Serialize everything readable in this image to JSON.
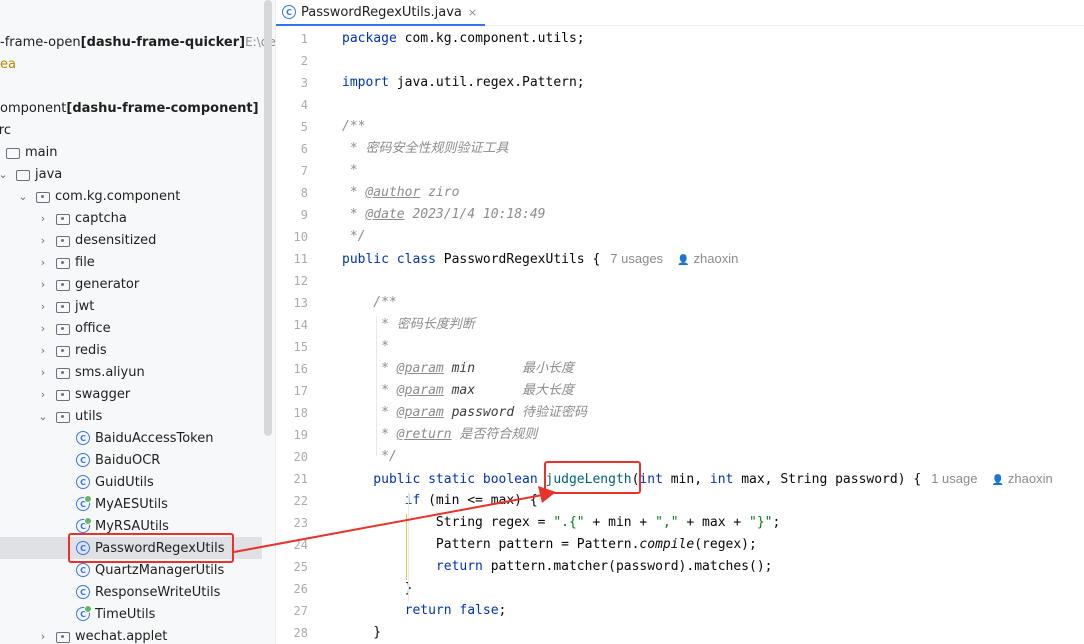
{
  "tree": {
    "rows": [
      {
        "parts": [
          {
            "t": "-frame-open ",
            "c": ""
          },
          {
            "t": "[dashu-frame-quicker]",
            "c": "bold"
          },
          {
            "t": "  E:\\de",
            "c": "dim"
          }
        ]
      },
      {
        "parts": [
          {
            "t": "ea",
            "c": "modcol"
          }
        ]
      },
      {
        "parts": []
      },
      {
        "parts": [
          {
            "t": "omponent ",
            "c": ""
          },
          {
            "t": "[dashu-frame-component]",
            "c": "bold"
          }
        ]
      },
      {
        "parts": [
          {
            "t": "src",
            "c": ""
          }
        ]
      },
      {
        "parts": [
          {
            "t": "main",
            "c": ""
          }
        ]
      },
      {
        "parts": [
          {
            "t": "java",
            "c": ""
          }
        ]
      },
      {
        "parts": [
          {
            "t": "com.kg.component",
            "c": ""
          }
        ]
      },
      {
        "parts": [
          {
            "t": "captcha",
            "c": ""
          }
        ]
      },
      {
        "parts": [
          {
            "t": "desensitized",
            "c": ""
          }
        ]
      },
      {
        "parts": [
          {
            "t": "file",
            "c": ""
          }
        ]
      },
      {
        "parts": [
          {
            "t": "generator",
            "c": ""
          }
        ]
      },
      {
        "parts": [
          {
            "t": "jwt",
            "c": ""
          }
        ]
      },
      {
        "parts": [
          {
            "t": "office",
            "c": ""
          }
        ]
      },
      {
        "parts": [
          {
            "t": "redis",
            "c": ""
          }
        ]
      },
      {
        "parts": [
          {
            "t": "sms.aliyun",
            "c": ""
          }
        ]
      },
      {
        "parts": [
          {
            "t": "swagger",
            "c": ""
          }
        ]
      },
      {
        "parts": [
          {
            "t": "utils",
            "c": ""
          }
        ]
      },
      {
        "parts": [
          {
            "t": "BaiduAccessToken",
            "c": ""
          }
        ]
      },
      {
        "parts": [
          {
            "t": "BaiduOCR",
            "c": ""
          }
        ]
      },
      {
        "parts": [
          {
            "t": "GuidUtils",
            "c": ""
          }
        ]
      },
      {
        "parts": [
          {
            "t": "MyAESUtils",
            "c": ""
          }
        ]
      },
      {
        "parts": [
          {
            "t": "MyRSAUtils",
            "c": ""
          }
        ]
      },
      {
        "parts": [
          {
            "t": "PasswordRegexUtils",
            "c": ""
          }
        ]
      },
      {
        "parts": [
          {
            "t": "QuartzManagerUtils",
            "c": ""
          }
        ]
      },
      {
        "parts": [
          {
            "t": "ResponseWriteUtils",
            "c": ""
          }
        ]
      },
      {
        "parts": [
          {
            "t": "TimeUtils",
            "c": ""
          }
        ]
      },
      {
        "parts": [
          {
            "t": "wechat.applet",
            "c": ""
          }
        ]
      }
    ]
  },
  "editor": {
    "tab": {
      "label": "PasswordRegexUtils.java",
      "close": "×"
    },
    "lines": [
      {
        "n": "1",
        "parts": [
          {
            "t": "package ",
            "c": "kw"
          },
          {
            "t": "com.kg.component.utils;",
            "c": ""
          }
        ]
      },
      {
        "n": "2",
        "parts": []
      },
      {
        "n": "3",
        "parts": [
          {
            "t": "import ",
            "c": "kw"
          },
          {
            "t": "java.util.regex.Pattern;",
            "c": ""
          }
        ]
      },
      {
        "n": "4",
        "parts": []
      },
      {
        "n": "5",
        "parts": [
          {
            "t": "/**",
            "c": "cm"
          }
        ]
      },
      {
        "n": "6",
        "parts": [
          {
            "t": " * 密码安全性规则验证工具",
            "c": "cm"
          }
        ]
      },
      {
        "n": "7",
        "parts": [
          {
            "t": " *",
            "c": "cm"
          }
        ]
      },
      {
        "n": "8",
        "parts": [
          {
            "t": " * ",
            "c": "cm"
          },
          {
            "t": "@author",
            "c": "tag"
          },
          {
            "t": " ziro",
            "c": "cm"
          }
        ]
      },
      {
        "n": "9",
        "parts": [
          {
            "t": " * ",
            "c": "cm"
          },
          {
            "t": "@date",
            "c": "tag"
          },
          {
            "t": " 2023/1/4 10:18:49",
            "c": "cm"
          }
        ]
      },
      {
        "n": "10",
        "parts": [
          {
            "t": " */",
            "c": "cm"
          }
        ]
      },
      {
        "n": "11",
        "parts": [
          {
            "t": "public class ",
            "c": "kw"
          },
          {
            "t": "PasswordRegexUtils {",
            "c": ""
          },
          {
            "t": "7 usages",
            "c": "hint"
          },
          {
            "t": "zhaoxin",
            "c": "hint-user"
          }
        ]
      },
      {
        "n": "12",
        "parts": []
      },
      {
        "n": "13",
        "parts": [
          {
            "t": "    /**",
            "c": "cm"
          }
        ]
      },
      {
        "n": "14",
        "parts": [
          {
            "t": "     * 密码长度判断",
            "c": "cm"
          }
        ]
      },
      {
        "n": "15",
        "parts": [
          {
            "t": "     *",
            "c": "cm"
          }
        ]
      },
      {
        "n": "16",
        "parts": [
          {
            "t": "     * ",
            "c": "cm"
          },
          {
            "t": "@param",
            "c": "tag"
          },
          {
            "t": " min",
            "c": "pname"
          },
          {
            "t": "      最小长度",
            "c": "cm"
          }
        ]
      },
      {
        "n": "17",
        "parts": [
          {
            "t": "     * ",
            "c": "cm"
          },
          {
            "t": "@param",
            "c": "tag"
          },
          {
            "t": " max",
            "c": "pname"
          },
          {
            "t": "      最大长度",
            "c": "cm"
          }
        ]
      },
      {
        "n": "18",
        "parts": [
          {
            "t": "     * ",
            "c": "cm"
          },
          {
            "t": "@param",
            "c": "tag"
          },
          {
            "t": " password",
            "c": "pname"
          },
          {
            "t": " 待验证密码",
            "c": "cm"
          }
        ]
      },
      {
        "n": "19",
        "parts": [
          {
            "t": "     * ",
            "c": "cm"
          },
          {
            "t": "@return",
            "c": "tag"
          },
          {
            "t": " 是否符合规则",
            "c": "cm"
          }
        ]
      },
      {
        "n": "20",
        "parts": [
          {
            "t": "     */",
            "c": "cm"
          }
        ]
      },
      {
        "n": "21",
        "parts": [
          {
            "t": "    public static boolean ",
            "c": "kw"
          },
          {
            "t": "judgeLength",
            "c": "mth"
          },
          {
            "t": "(",
            "c": ""
          },
          {
            "t": "int ",
            "c": "kw"
          },
          {
            "t": "min, ",
            "c": ""
          },
          {
            "t": "int ",
            "c": "kw"
          },
          {
            "t": "max, String password) {",
            "c": ""
          },
          {
            "t": "1 usage",
            "c": "hint"
          },
          {
            "t": "zhaoxin",
            "c": "hint-user"
          }
        ]
      },
      {
        "n": "22",
        "parts": [
          {
            "t": "        if ",
            "c": "kw"
          },
          {
            "t": "(min <= max) {",
            "c": ""
          }
        ]
      },
      {
        "n": "23",
        "parts": [
          {
            "t": "            String regex = ",
            "c": ""
          },
          {
            "t": "\".{\"",
            "c": "str"
          },
          {
            "t": " + min + ",
            "c": ""
          },
          {
            "t": "\",\"",
            "c": "str"
          },
          {
            "t": " + max + ",
            "c": ""
          },
          {
            "t": "\"}\"",
            "c": "str"
          },
          {
            "t": ";",
            "c": ""
          }
        ]
      },
      {
        "n": "24",
        "parts": [
          {
            "t": "            Pattern pattern = Pattern.",
            "c": ""
          },
          {
            "t": "compile",
            "c": "static"
          },
          {
            "t": "(regex);",
            "c": ""
          }
        ]
      },
      {
        "n": "25",
        "parts": [
          {
            "t": "            return ",
            "c": "kw"
          },
          {
            "t": "pattern.matcher(password).matches();",
            "c": ""
          }
        ]
      },
      {
        "n": "26",
        "parts": [
          {
            "t": "        }",
            "c": ""
          }
        ]
      },
      {
        "n": "27",
        "parts": [
          {
            "t": "        return false",
            "c": "kw"
          },
          {
            "t": ";",
            "c": ""
          }
        ]
      },
      {
        "n": "28",
        "parts": [
          {
            "t": "    }",
            "c": ""
          }
        ]
      }
    ]
  },
  "colors": {
    "accent": "#3574f0",
    "annotation": "#e8322a",
    "selection": "#dfe1e5"
  }
}
